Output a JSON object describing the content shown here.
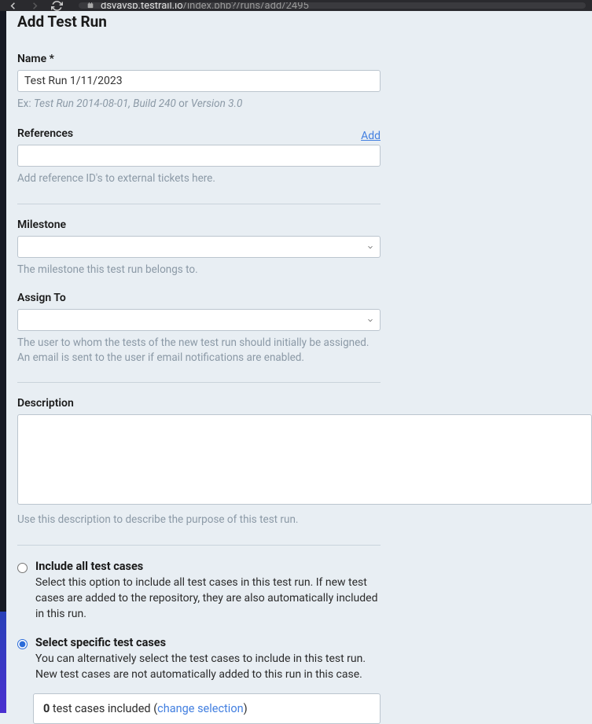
{
  "browser": {
    "url_domain": "dsvavsp.testrail.io",
    "url_path": "/index.php?/runs/add/2495"
  },
  "page": {
    "title": "Add Test Run"
  },
  "form": {
    "name": {
      "label": "Name *",
      "value": "Test Run 1/11/2023",
      "help_prefix": "Ex: ",
      "help_example1": "Test Run 2014-08-01",
      "help_sep1": ", ",
      "help_example2": "Build 240",
      "help_sep2": " or ",
      "help_example3": "Version 3.0"
    },
    "references": {
      "label": "References",
      "add_link": "Add",
      "value": "",
      "help": "Add reference ID's to external tickets here."
    },
    "milestone": {
      "label": "Milestone",
      "value": "",
      "help": "The milestone this test run belongs to."
    },
    "assign_to": {
      "label": "Assign To",
      "value": "",
      "help": "The user to whom the tests of the new test run should initially be assigned. An email is sent to the user if email notifications are enabled."
    },
    "description": {
      "label": "Description",
      "value": "",
      "help": "Use this description to describe the purpose of this test run."
    },
    "include_mode": {
      "all": {
        "label": "Include all test cases",
        "desc": "Select this option to include all test cases in this test run. If new test cases are added to the repository, they are also automatically included in this run."
      },
      "specific": {
        "label": "Select specific test cases",
        "desc": "You can alternatively select the test cases to include in this test run. New test cases are not automatically added to this run in this case.",
        "count": "0",
        "included_text": " test cases included (",
        "change_link": "change selection",
        "close_paren": ")"
      }
    }
  }
}
